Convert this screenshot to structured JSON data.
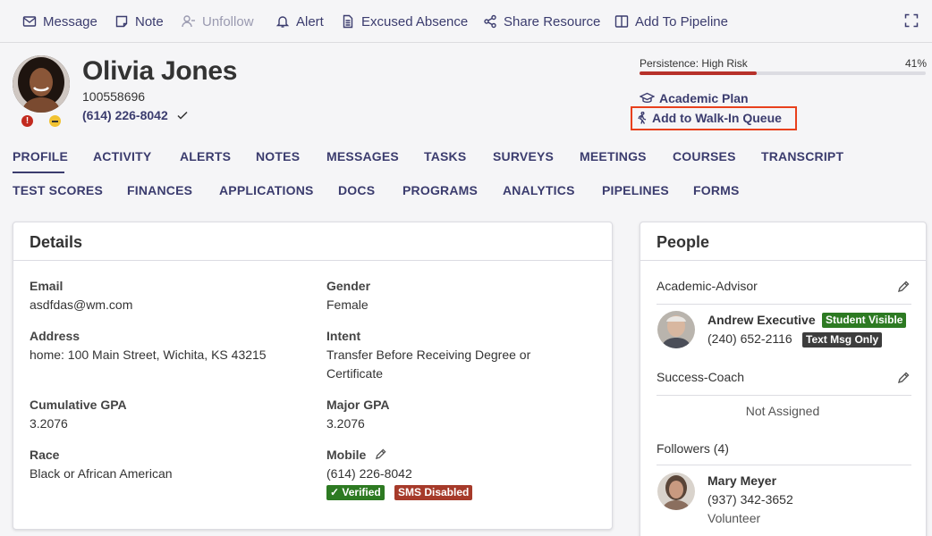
{
  "toolbar": {
    "message": "Message",
    "note": "Note",
    "unfollow": "Unfollow",
    "alert": "Alert",
    "excused_absence": "Excused Absence",
    "share_resource": "Share Resource",
    "add_to_pipeline": "Add To Pipeline"
  },
  "student": {
    "name": "Olivia Jones",
    "id": "100558696",
    "phone": "(614) 226-8042",
    "alert_glyph": "!"
  },
  "persistence": {
    "label": "Persistence: High Risk",
    "percent_label": "41%",
    "value": 0.41,
    "color": "#b7312a"
  },
  "links": {
    "academic_plan": "Academic Plan",
    "walk_in": "Add to Walk-In Queue"
  },
  "tabs_row1": [
    "PROFILE",
    "ACTIVITY",
    "ALERTS",
    "NOTES",
    "MESSAGES",
    "TASKS",
    "SURVEYS",
    "MEETINGS",
    "COURSES",
    "TRANSCRIPT"
  ],
  "tabs_row2": [
    "TEST SCORES",
    "FINANCES",
    "APPLICATIONS",
    "DOCS",
    "PROGRAMS",
    "ANALYTICS",
    "PIPELINES",
    "FORMS"
  ],
  "details": {
    "title": "Details",
    "email_label": "Email",
    "email": "asdfdas@wm.com",
    "address_label": "Address",
    "address": "home: 100 Main Street, Wichita, KS 43215",
    "gpa_label": "Cumulative GPA",
    "gpa": "3.2076",
    "race_label": "Race",
    "race": "Black or African American",
    "gender_label": "Gender",
    "gender": "Female",
    "intent_label": "Intent",
    "intent_line1": "Transfer Before Receiving Degree or",
    "intent_line2": "Certificate",
    "major_gpa_label": "Major GPA",
    "major_gpa": "3.2076",
    "mobile_label": "Mobile",
    "mobile": "(614) 226-8042",
    "verified_badge": "✓ Verified",
    "sms_badge": "SMS Disabled"
  },
  "people": {
    "title": "People",
    "advisor_role": "Academic-Advisor",
    "advisor_name": "Andrew Executive",
    "advisor_phone": "(240) 652-2116",
    "advisor_badge1": "Student Visible",
    "advisor_badge2": "Text Msg Only",
    "coach_role": "Success-Coach",
    "not_assigned": "Not Assigned",
    "followers_label": "Followers (4)",
    "follower_name": "Mary Meyer",
    "follower_phone": "(937) 342-3652",
    "follower_role": "Volunteer"
  },
  "colors": {
    "accent": "#3b3c6e",
    "highlight": "#e8401c",
    "verified": "#2d7a22",
    "sms_disabled": "#a63a2a"
  }
}
